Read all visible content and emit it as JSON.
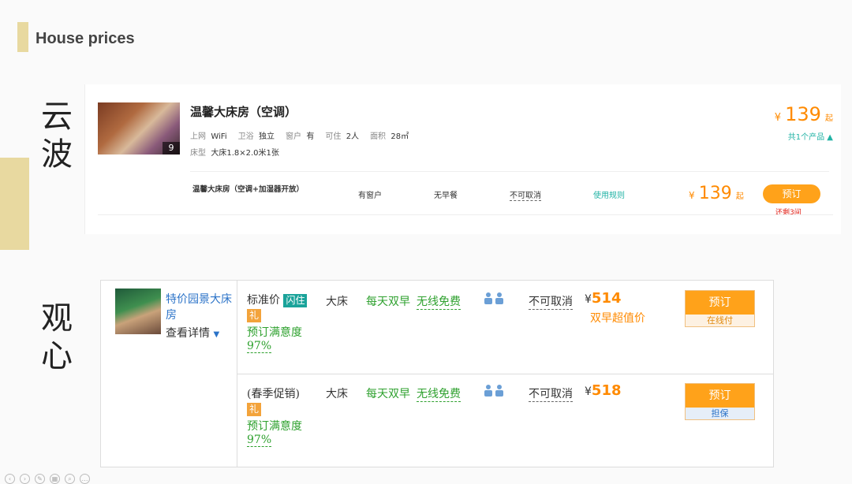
{
  "slide": {
    "title": "House prices",
    "calligraphy_1": [
      "云",
      "波"
    ],
    "calligraphy_2": [
      "观",
      "心"
    ]
  },
  "card1": {
    "thumb_count": "9",
    "room_name": "温馨大床房（空调）",
    "specs": [
      {
        "label": "上网",
        "value": "WiFi"
      },
      {
        "label": "卫浴",
        "value": "独立"
      },
      {
        "label": "窗户",
        "value": "有"
      },
      {
        "label": "可住",
        "value": "2人"
      },
      {
        "label": "面积",
        "value": "28㎡"
      }
    ],
    "bed_label": "床型",
    "bed_value": "大床1.8×2.0米1张",
    "price_currency": "¥",
    "price": "139",
    "price_suffix": "起",
    "products_count": "共1个产品",
    "offer": {
      "name": "温馨大床房（空调+加湿器开放）",
      "window": "有窗户",
      "breakfast": "无早餐",
      "cancel": "不可取消",
      "rules": "使用规则",
      "price_currency": "¥",
      "price": "139",
      "price_suffix": "起",
      "book": "预订",
      "remaining": "还剩3间"
    }
  },
  "card2": {
    "room_name": "特价园景大床房",
    "details": "查看详情",
    "rows": [
      {
        "rate": "标准价",
        "flash_badge": "闪住",
        "gift_badge": "礼",
        "satisfaction_label": "预订满意度",
        "satisfaction_value": "97%",
        "bed": "大床",
        "breakfast": "每天双早",
        "wifi": "无线免费",
        "cancel": "不可取消",
        "currency": "¥",
        "price": "514",
        "note": "双早超值价",
        "book": "预订",
        "pay": "在线付"
      },
      {
        "rate": "(春季促销)",
        "gift_badge": "礼",
        "satisfaction_label": "预订满意度",
        "satisfaction_value": "97%",
        "bed": "大床",
        "breakfast": "每天双早",
        "wifi": "无线免费",
        "cancel": "不可取消",
        "currency": "¥",
        "price": "518",
        "book": "预订",
        "pay": "担保"
      }
    ]
  },
  "colors": {
    "accent": "#e8d9a0",
    "price_orange": "#ff8a00",
    "button_orange": "#ffa21a",
    "teal": "#22b3a5",
    "green": "#2fa12f",
    "link_blue": "#2b73c8"
  }
}
